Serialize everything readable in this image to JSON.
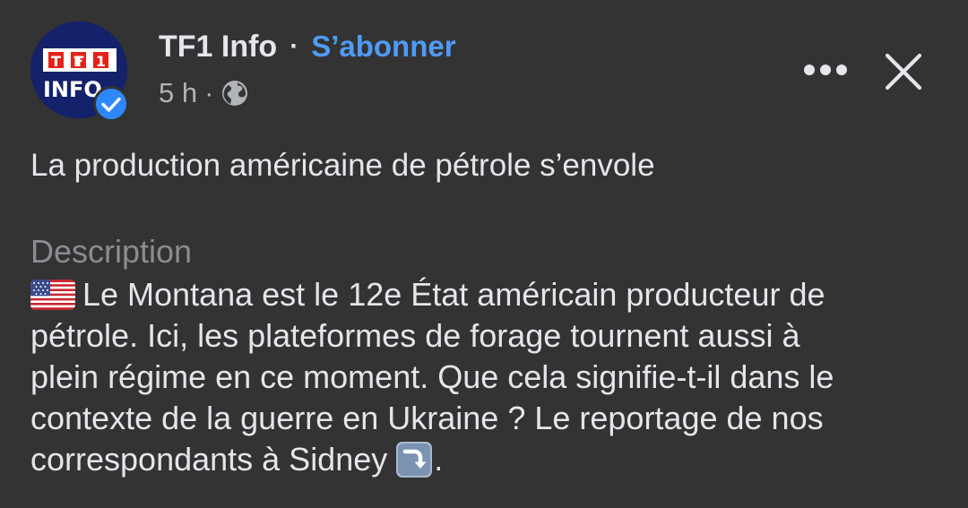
{
  "post": {
    "author": {
      "name": "TF1 Info",
      "avatar_text_top": "TF1",
      "avatar_text_bottom": "INFO"
    },
    "follow_label": "S’abonner",
    "separator": "·",
    "time": "5 h",
    "privacy_icon": "globe-icon",
    "title": "La production américaine de pétrole s’envole",
    "description_label": "Description",
    "description_lines": [
      "Le Montana est le 12e État américain producteur de",
      "pétrole. Ici, les plateformes de forage tournent aussi à",
      "plein régime en ce moment. Que cela signifie-t-il dans le",
      "contexte de la guerre en Ukraine ? Le reportage de nos",
      "correspondants à Sidney"
    ],
    "description_end": ".",
    "icons": {
      "flag": "us-flag-icon",
      "arrow": "arrow-down-right-icon",
      "more": "more-options-icon",
      "close": "close-icon",
      "verified": "verified-badge-icon"
    }
  },
  "colors": {
    "background": "#333334",
    "text": "#e4e6eb",
    "muted": "#b0b3b8",
    "link": "#4f9bf5",
    "verified": "#2d88ff",
    "logo_bg": "#14216b"
  }
}
